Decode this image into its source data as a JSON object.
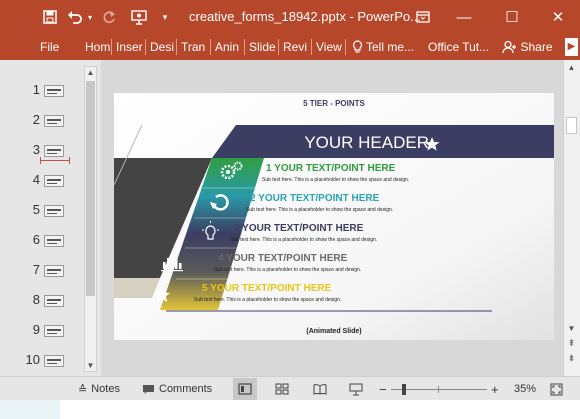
{
  "window": {
    "title": "creative_forms_18942.pptx - PowerPo...",
    "minimize_icon": "—",
    "maximize_icon": "☐",
    "close_icon": "✕"
  },
  "ribbon": {
    "tabs": [
      "File",
      "Hom",
      "Inser",
      "Desi",
      "Tran",
      "Anin",
      "Slide",
      "Revi",
      "View"
    ],
    "tell_me": "Tell me...",
    "office_tut": "Office Tut...",
    "share": "Share"
  },
  "thumbnails": [
    "1",
    "2",
    "3",
    "4",
    "5",
    "6",
    "7",
    "8",
    "9",
    "10"
  ],
  "slide": {
    "top_title": "5 TIER - POINTS",
    "header": "YOUR HEADER",
    "points": [
      {
        "label": "1 YOUR TEXT/POINT HERE",
        "color": "#2e9b3e",
        "sub": "Sub text here. This is a placeholder to show the space and design."
      },
      {
        "label": "2 YOUR TEXT/POINT HERE",
        "color": "#2aa3b4",
        "sub": "Sub text here. This is a placeholder to show the space and design."
      },
      {
        "label": "3 YOUR TEXT/POINT HERE",
        "color": "#3d3d5c",
        "sub": "Sub text here. This is a placeholder to show the space and design."
      },
      {
        "label": "4 YOUR TEXT/POINT HERE",
        "color": "#6a6a6a",
        "sub": "Sub text here. This is a placeholder to show the space and design."
      },
      {
        "label": "5 YOUR TEXT/POINT HERE",
        "color": "#e6c619",
        "sub": "Sub text here. This is a placeholder to show the space and design."
      }
    ],
    "footer": "(Animated Slide)",
    "colors": {
      "header_band": "#3c3d62",
      "dark_block": "#444444"
    }
  },
  "status": {
    "notes": "Notes",
    "comments": "Comments",
    "zoom": "35%",
    "minus": "−",
    "plus": "+"
  }
}
